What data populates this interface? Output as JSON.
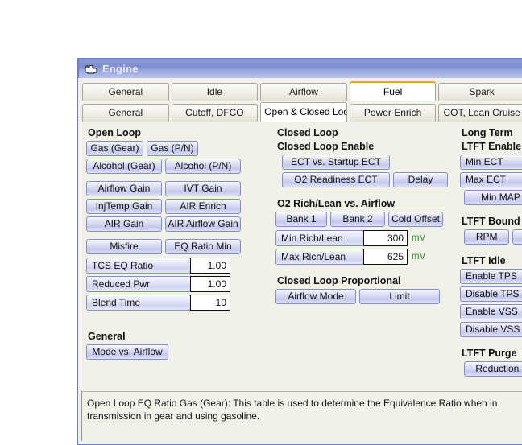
{
  "window": {
    "title": "Engine",
    "icon": "check-engine-icon"
  },
  "colors": {
    "titlebar_blue": "#7d8ed1",
    "button_face": "#d2d5f0",
    "button_border": "#7f8fc9",
    "selected_tab_accent": "#e9a227",
    "panel_background": "#f1f0e9",
    "unit_green": "#2f8f2f"
  },
  "tabs_primary": [
    {
      "label": "General",
      "selected": false
    },
    {
      "label": "Idle",
      "selected": false
    },
    {
      "label": "Airflow",
      "selected": false
    },
    {
      "label": "Fuel",
      "selected": true
    },
    {
      "label": "Spark",
      "selected": false
    }
  ],
  "tabs_secondary": [
    {
      "label": "General",
      "selected": false
    },
    {
      "label": "Cutoff, DFCO",
      "selected": false
    },
    {
      "label": "Open & Closed Loop",
      "selected": true
    },
    {
      "label": "Power Enrich",
      "selected": false
    },
    {
      "label": "COT, Lean Cruise",
      "selected": false
    }
  ],
  "open_loop": {
    "heading": "Open Loop",
    "buttons": [
      [
        "Gas (Gear)",
        "Gas (P/N)"
      ],
      [
        "Alcohol (Gear)",
        "Alcohol (P/N)"
      ],
      [
        "Airflow Gain",
        "IVT Gain"
      ],
      [
        "InjTemp Gain",
        "AIR Enrich"
      ],
      [
        "AIR Gain",
        "AIR Airflow Gain"
      ],
      [
        "Misfire",
        "EQ Ratio Min"
      ]
    ],
    "values": [
      {
        "label": "TCS EQ Ratio",
        "value": "1.00"
      },
      {
        "label": "Reduced Pwr",
        "value": "1.00"
      },
      {
        "label": "Blend Time",
        "value": "10"
      }
    ]
  },
  "general": {
    "heading": "General",
    "buttons": [
      "Mode vs. Airflow"
    ]
  },
  "closed_loop": {
    "heading": "Closed Loop",
    "enable_heading": "Closed Loop Enable",
    "enable_buttons_row1": [
      "ECT vs. Startup ECT"
    ],
    "enable_buttons_row2": [
      "O2 Readiness ECT",
      "Delay"
    ],
    "o2_heading": "O2 Rich/Lean vs. Airflow",
    "o2_buttons": [
      "Bank 1",
      "Bank 2",
      "Cold Offset"
    ],
    "o2_values": [
      {
        "label": "Min Rich/Lean",
        "value": "300",
        "unit": "mV"
      },
      {
        "label": "Max Rich/Lean",
        "value": "625",
        "unit": "mV"
      }
    ],
    "proportional_heading": "Closed Loop Proportional",
    "proportional_buttons": [
      "Airflow Mode",
      "Limit"
    ]
  },
  "long_term": {
    "heading": "Long Term",
    "enable_heading": "LTFT Enable",
    "enable_buttons": [
      "Min ECT",
      "Max ECT",
      "Min MAP v"
    ],
    "bounds_heading": "LTFT Bound",
    "bounds_buttons": [
      "RPM"
    ],
    "idle_heading": "LTFT Idle",
    "idle_buttons": [
      "Enable TPS",
      "Disable TPS",
      "Enable VSS",
      "Disable VSS"
    ],
    "purge_heading": "LTFT Purge",
    "purge_buttons": [
      "Reduction Fa"
    ]
  },
  "statusbar": {
    "text": "Open Loop EQ Ratio Gas (Gear): This table is used to determine the Equivalence Ratio when in transmission in gear and using gasoline."
  }
}
